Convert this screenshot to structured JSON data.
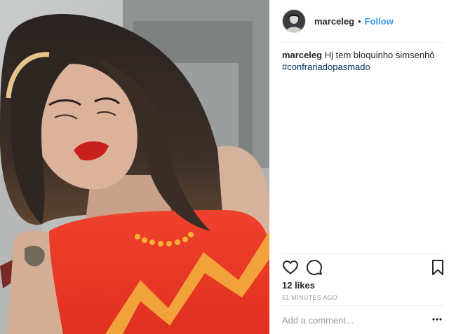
{
  "post": {
    "username": "marceleg",
    "follow_label": "Follow",
    "separator": "•",
    "caption_text": "Hj tem bloquinho simsenhô",
    "hashtag": "#confrariadopasmado",
    "likes": "12 likes",
    "timestamp": "51 MINUTES AGO",
    "comment_placeholder": "Add a comment...",
    "more_label": "•••"
  },
  "icons": {
    "like": "heart-icon",
    "comment": "comment-icon",
    "save": "bookmark-icon",
    "more": "more-options-icon"
  },
  "colors": {
    "link": "#3897f0",
    "hashtag": "#003569",
    "muted": "#999999"
  }
}
